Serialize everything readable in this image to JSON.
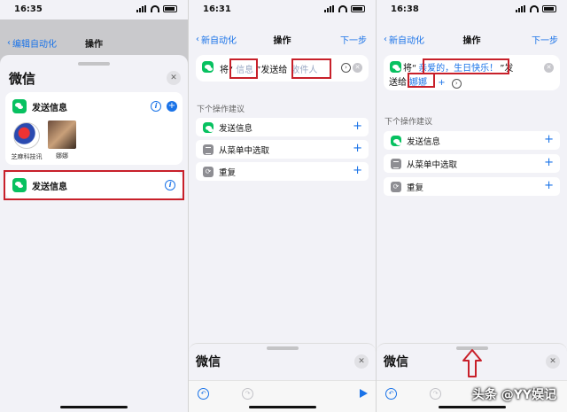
{
  "panel1": {
    "time": "16:35",
    "nav_back": "编辑自动化",
    "nav_title": "操作",
    "sheet_title": "微信",
    "card1_label": "发送信息",
    "contacts": [
      {
        "name": "芝麻科技讯"
      },
      {
        "name": "娜娜"
      }
    ],
    "card2_label": "发送信息"
  },
  "panel2": {
    "time": "16:31",
    "nav_back": "新自动化",
    "nav_title": "操作",
    "nav_next": "下一步",
    "action": {
      "prefix": "将“",
      "message_placeholder": "信息",
      "middle": "”发送给",
      "recipient_placeholder": "收件人"
    },
    "suggestions_title": "下个操作建议",
    "suggestions": [
      "发送信息",
      "从菜单中选取",
      "重复"
    ],
    "bottom_title": "微信"
  },
  "panel3": {
    "time": "16:38",
    "nav_back": "新自动化",
    "nav_title": "操作",
    "nav_next": "下一步",
    "action": {
      "prefix": "将“",
      "message_value": "亲爱的，生日快乐！",
      "middle1": "”发",
      "middle2": "送给",
      "recipient_value": "娜娜"
    },
    "suggestions_title": "下个操作建议",
    "suggestions": [
      "发送信息",
      "从菜单中选取",
      "重复"
    ],
    "bottom_title": "微信"
  },
  "watermark": "头条 @YY娱记",
  "colors": {
    "accent": "#1a73e8",
    "annotation_red": "#c8202a",
    "wechat_green": "#07c160"
  }
}
